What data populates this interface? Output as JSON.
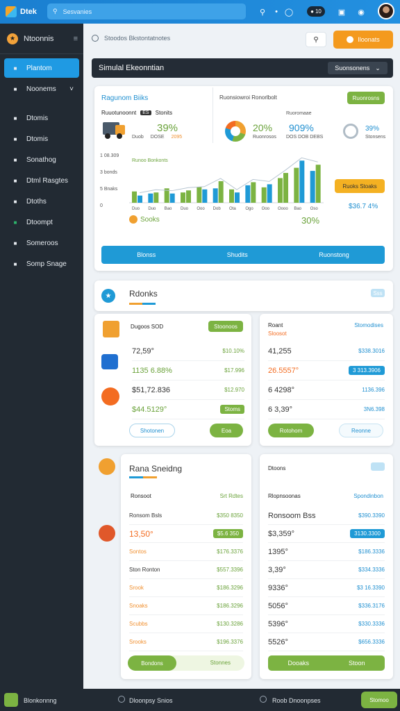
{
  "topbar": {
    "app_name": "Dtek",
    "search_placeholder": "Sesvanies",
    "badge": "10"
  },
  "sidebar": {
    "header": "Ntoonnis",
    "items": [
      {
        "label": "Plantom",
        "active": true,
        "icon": "person-icon"
      },
      {
        "label": "Noonems",
        "active": false,
        "icon": "bag-icon"
      },
      {
        "label": "Dtomis",
        "active": false,
        "icon": "link-icon"
      },
      {
        "label": "Dtomis",
        "active": false,
        "icon": "tag-icon"
      },
      {
        "label": "Sonathog",
        "active": false,
        "icon": "heart-icon"
      },
      {
        "label": "Dtml Rasgtes",
        "active": false,
        "icon": "list-icon"
      },
      {
        "label": "Dtoths",
        "active": false,
        "icon": "calendar-icon"
      },
      {
        "label": "Dtoompt",
        "active": false,
        "icon": "book-icon"
      },
      {
        "label": "Someroos",
        "active": false,
        "icon": "search-icon"
      },
      {
        "label": "Somp Snage",
        "active": false,
        "icon": "wallet-icon"
      }
    ]
  },
  "header": {
    "breadcrumb": "Stoodos Bkstontatnotes",
    "action_label": "Iloonats",
    "title": "Simulal Ekeonntian",
    "select_label": "Suonsonens"
  },
  "overview": {
    "left_title": "Ragunom Biiks",
    "tab_a": "Ruuotunoonnt",
    "tab_b": "Stonits",
    "tab_b_badge": "ES",
    "stat_a_value": "39%",
    "stat_a_sub": "Duob",
    "stat_a_sub2": "DOSE",
    "stat_a_accent": "2095",
    "right_title": "Ruonsiowroi Ronorlbolt",
    "right_pill": "Ruonrosns",
    "stat_b_value": "20%",
    "stat_b_sub": "Ruonrosos",
    "stat_c_value": "909%",
    "stat_c_tag": "Ruoromaae",
    "stat_c_sub": "DOS DOB DEBS",
    "stat_d_value": "39%",
    "stat_d_sub": "Stonsens",
    "chart_caption": "Runoo Bonkonts",
    "orange_pill": "Ruoks Stoaks",
    "chart_footer_a": "Sooks",
    "chart_footer_b": "30%",
    "chart_footer_c": "$36.7 4%",
    "btn_left": "Blonss",
    "btn_mid": "Shudits",
    "btn_right": "Ruonstong"
  },
  "chart_data": {
    "type": "bar",
    "categories": [
      "Duo",
      "Duo",
      "Bao",
      "Duo",
      "Ooo",
      "Dob",
      "Ota",
      "Ogo",
      "Ooo",
      "Oooo",
      "Bao",
      "Oso"
    ],
    "series": [
      {
        "values": [
          22,
          18,
          28,
          20,
          31,
          28,
          26,
          34,
          30,
          48,
          68,
          62
        ]
      },
      {
        "values": [
          14,
          20,
          18,
          24,
          26,
          42,
          20,
          40,
          36,
          58,
          82,
          74
        ]
      }
    ],
    "yticks": [
      "1 08.309",
      "3 bonds",
      "5 Bnaks",
      "0"
    ],
    "ylim": [
      0,
      100
    ]
  },
  "accounts": {
    "title": "Rdonks",
    "title_pill": "Sss",
    "col_a_title": "Dugoos SOD",
    "col_a_pill": "Stoonoos",
    "col_b_title": "Roant",
    "col_b_sub": "Sloosot",
    "col_b_right": "Stomodises",
    "rows_left": [
      {
        "value": "72,59°",
        "right": "$10.10%"
      },
      {
        "value": "1135 6.88%",
        "right": "$17.996"
      },
      {
        "value": "$51,72.836",
        "right": "$12.970"
      },
      {
        "value": "$44.5129°",
        "right": "Stoms"
      }
    ],
    "rows_right": [
      {
        "value": "41,255",
        "right": "$338.3016"
      },
      {
        "value": "26.5557°",
        "right": "3 313.3906"
      },
      {
        "value": "6 4298°",
        "right": "1136.396"
      },
      {
        "value": "6 3,39°",
        "right": "3N6.398"
      }
    ],
    "btn_left_a": "Shotonen",
    "btn_left_b": "Eoa",
    "btn_right_a": "Rotohom",
    "btn_right_b": "Reonne"
  },
  "planning": {
    "title": "Rana Sneidng",
    "left_head": "Ronsoot",
    "left_head_right": "Srt Rdtes",
    "right_title": "Dtoons",
    "right_head": "Rlopnsoonas",
    "right_head_right": "Spondinbon",
    "left_rows": [
      {
        "label": "Ronsom Bsls",
        "right": "$350 8350"
      },
      {
        "label": "13,50°",
        "right": "$5.6 350"
      },
      {
        "label": "Sontos",
        "right": "$176.3376"
      },
      {
        "label": "Ston Ronton",
        "right": "$557.3396"
      },
      {
        "label": "Srook",
        "right": "$186.3296"
      },
      {
        "label": "Snoaks",
        "right": "$186.3296"
      },
      {
        "label": "Scubbs",
        "right": "$130.3286"
      },
      {
        "label": "Srooks",
        "right": "$196.3376"
      }
    ],
    "right_rows": [
      {
        "label": "Ronsoom Bss",
        "right": "$390.3390"
      },
      {
        "label": "$3,359°",
        "right": "3130.3300"
      },
      {
        "label": "1395°",
        "right": "$186.3336"
      },
      {
        "label": "3,39°",
        "right": "$334.3336"
      },
      {
        "label": "9336°",
        "right": "$3 16.3390"
      },
      {
        "label": "5056°",
        "right": "$336.3176"
      },
      {
        "label": "5396°",
        "right": "$330.3336"
      },
      {
        "label": "5526°",
        "right": "$656.3336"
      }
    ],
    "btn_left_a": "Bondons",
    "btn_left_b": "Stonnes",
    "btn_right_a": "Dooaks",
    "btn_right_b": "Stoon"
  },
  "footer": {
    "left": "Blonkonnng",
    "mid": "Dloonpsy Snios",
    "right": "Roob Dnoonpses",
    "button": "Stomoo"
  }
}
